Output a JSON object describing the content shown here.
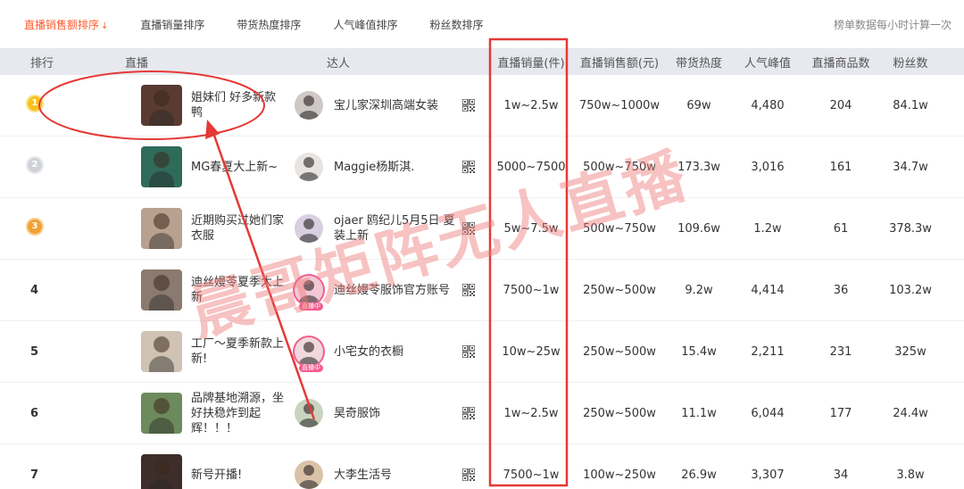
{
  "tabs": [
    {
      "label": "直播销售额排序",
      "active": true
    },
    {
      "label": "直播销量排序",
      "active": false
    },
    {
      "label": "带货热度排序",
      "active": false
    },
    {
      "label": "人气峰值排序",
      "active": false
    },
    {
      "label": "粉丝数排序",
      "active": false
    }
  ],
  "update_note": "榜单数据每小时计算一次",
  "columns": {
    "rank": "排行",
    "live": "直播",
    "star": "达人",
    "sales": "直播销量(件)",
    "gmv": "直播销售额(元)",
    "heat": "带货热度",
    "peak": "人气峰值",
    "goods": "直播商品数",
    "fans": "粉丝数"
  },
  "rows": [
    {
      "rank": "1",
      "medal": "gold",
      "title": "姐妹们 好多新款鸭",
      "star": "宝儿家深圳高端女装",
      "star_live": false,
      "sales": "1w~2.5w",
      "gmv": "750w~1000w",
      "heat": "69w",
      "peak": "4,480",
      "goods": "204",
      "fans": "84.1w"
    },
    {
      "rank": "2",
      "medal": "silver",
      "title": "MG春夏大上新~",
      "star": "Maggie杨斯淇.",
      "star_live": false,
      "sales": "5000~7500",
      "gmv": "500w~750w",
      "heat": "173.3w",
      "peak": "3,016",
      "goods": "161",
      "fans": "34.7w"
    },
    {
      "rank": "3",
      "medal": "bronze",
      "title": "近期购买过她们家衣服",
      "star": "ojaer 鸥纪儿5月5日 夏装上新",
      "star_live": false,
      "sales": "5w~7.5w",
      "gmv": "500w~750w",
      "heat": "109.6w",
      "peak": "1.2w",
      "goods": "61",
      "fans": "378.3w"
    },
    {
      "rank": "4",
      "medal": "",
      "title": "迪丝嫚苓夏季大上新",
      "star": "迪丝嫚苓服饰官方账号",
      "star_live": true,
      "sales": "7500~1w",
      "gmv": "250w~500w",
      "heat": "9.2w",
      "peak": "4,414",
      "goods": "36",
      "fans": "103.2w"
    },
    {
      "rank": "5",
      "medal": "",
      "title": "工厂～夏季新款上新!",
      "star": "小宅女的衣橱",
      "star_live": true,
      "sales": "10w~25w",
      "gmv": "250w~500w",
      "heat": "15.4w",
      "peak": "2,211",
      "goods": "231",
      "fans": "325w"
    },
    {
      "rank": "6",
      "medal": "",
      "title": "品牌基地溯源，坐好扶稳炸到起辉！！！",
      "star": "昊奇服饰",
      "star_live": false,
      "sales": "1w~2.5w",
      "gmv": "250w~500w",
      "heat": "11.1w",
      "peak": "6,044",
      "goods": "177",
      "fans": "24.4w"
    },
    {
      "rank": "7",
      "medal": "",
      "title": "新号开播!",
      "star": "大李生活号",
      "star_live": false,
      "sales": "7500~1w",
      "gmv": "100w~250w",
      "heat": "26.9w",
      "peak": "3,307",
      "goods": "34",
      "fans": "3.8w"
    }
  ],
  "live_tag": "直播中",
  "watermark": "晨哥矩阵无人直播",
  "colors": {
    "accent": "#ff5a2c",
    "annotation": "#e53935",
    "header_bg": "#e7e9ef"
  }
}
